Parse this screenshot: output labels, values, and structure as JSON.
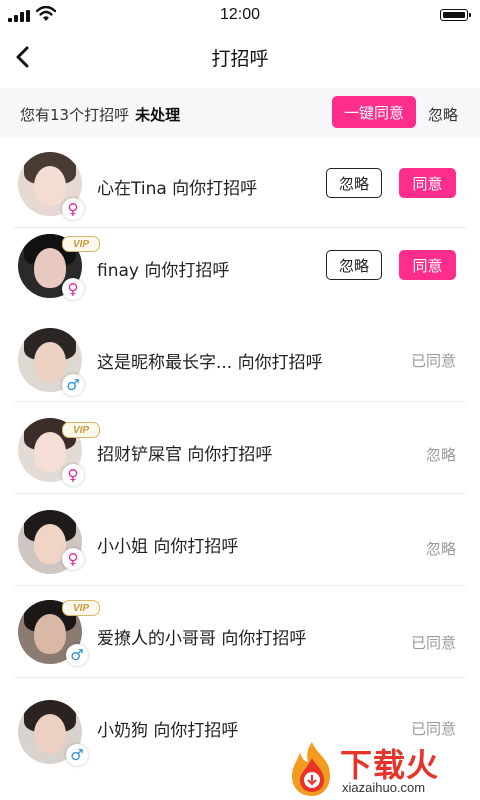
{
  "status_bar": {
    "time": "12:00"
  },
  "nav": {
    "title": "打招呼"
  },
  "summary": {
    "text": "您有13个打招呼",
    "highlight": "未处理",
    "agree_all_label": "一键同意",
    "ignore_all_label": "忽略"
  },
  "rows": [
    {
      "text": "心在Tina 向你打招呼",
      "gender": "female",
      "gender_symbol": "♀",
      "vip": false,
      "ignore_label": "忽略",
      "agree_label": "同意"
    },
    {
      "text": "finay 向你打招呼",
      "gender": "female",
      "gender_symbol": "♀",
      "vip": true,
      "vip_label": "VIP",
      "ignore_label": "忽略",
      "agree_label": "同意"
    },
    {
      "text": "这是昵称最长字... 向你打招呼",
      "gender": "male",
      "gender_symbol": "♂",
      "vip": false,
      "status": "已同意"
    },
    {
      "text": "招财铲屎官 向你打招呼",
      "gender": "female",
      "gender_symbol": "♀",
      "vip": true,
      "vip_label": "VIP",
      "status": "忽略"
    },
    {
      "text": "小小姐 向你打招呼",
      "gender": "female",
      "gender_symbol": "♀",
      "vip": false,
      "status": "忽略"
    },
    {
      "text": "爱撩人的小哥哥 向你打招呼",
      "gender": "male",
      "gender_symbol": "♂",
      "vip": true,
      "vip_label": "VIP",
      "status": "已同意"
    },
    {
      "text": "小奶狗 向你打招呼",
      "gender": "male",
      "gender_symbol": "♂",
      "vip": false,
      "status": "已同意"
    }
  ],
  "colors": {
    "accent": "#ff2d8c",
    "female": "#e0289b",
    "male": "#2d8fd8",
    "vip_gold": "#c59a3f",
    "status_gray": "#9a9a9a"
  },
  "watermark": {
    "title": "下载火",
    "url": "xiazaihuo.com"
  }
}
